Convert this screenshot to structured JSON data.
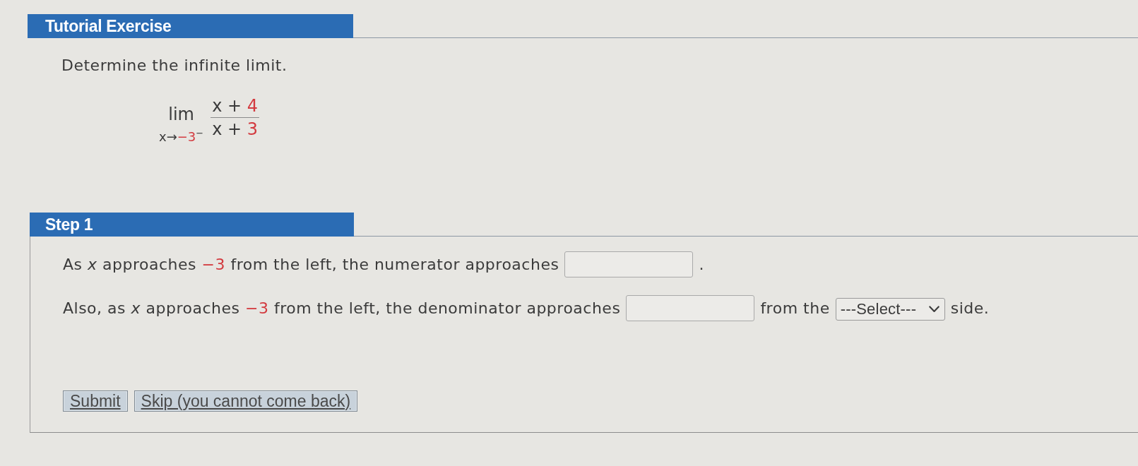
{
  "tutorial": {
    "title": "Tutorial Exercise",
    "prompt": "Determine the infinite limit.",
    "limit": {
      "operator": "lim",
      "approach": [
        {
          "kind": "text",
          "text": "x"
        },
        {
          "kind": "text",
          "text": "→"
        },
        {
          "kind": "value",
          "text": "−3"
        },
        {
          "kind": "sup",
          "text": "−"
        }
      ],
      "numerator": [
        {
          "kind": "text",
          "text": "x + "
        },
        {
          "kind": "value",
          "text": "4"
        }
      ],
      "denominator": [
        {
          "kind": "text",
          "text": "x + "
        },
        {
          "kind": "value",
          "text": "3"
        }
      ]
    }
  },
  "step": {
    "title": "Step 1",
    "lines": [
      [
        {
          "kind": "sentence",
          "parts": [
            {
              "kind": "text",
              "text": "As "
            },
            {
              "kind": "variable",
              "text": "x"
            },
            {
              "kind": "text",
              "text": " approaches "
            },
            {
              "kind": "value",
              "text": "−3"
            },
            {
              "kind": "text",
              "text": " from the left, the numerator approaches"
            }
          ]
        },
        {
          "kind": "input"
        },
        {
          "kind": "text",
          "text": "."
        }
      ],
      [
        {
          "kind": "sentence",
          "parts": [
            {
              "kind": "text",
              "text": "Also, as "
            },
            {
              "kind": "variable",
              "text": "x"
            },
            {
              "kind": "text",
              "text": " approaches "
            },
            {
              "kind": "value",
              "text": "−3"
            },
            {
              "kind": "text",
              "text": " from the left, the denominator approaches"
            }
          ]
        },
        {
          "kind": "input"
        },
        {
          "kind": "text",
          "text": "from the"
        },
        {
          "kind": "select",
          "value": "---Select---"
        },
        {
          "kind": "text",
          "text": "side."
        }
      ]
    ],
    "buttons": [
      {
        "label": "Submit"
      },
      {
        "label": "Skip (you cannot come back)"
      }
    ]
  }
}
